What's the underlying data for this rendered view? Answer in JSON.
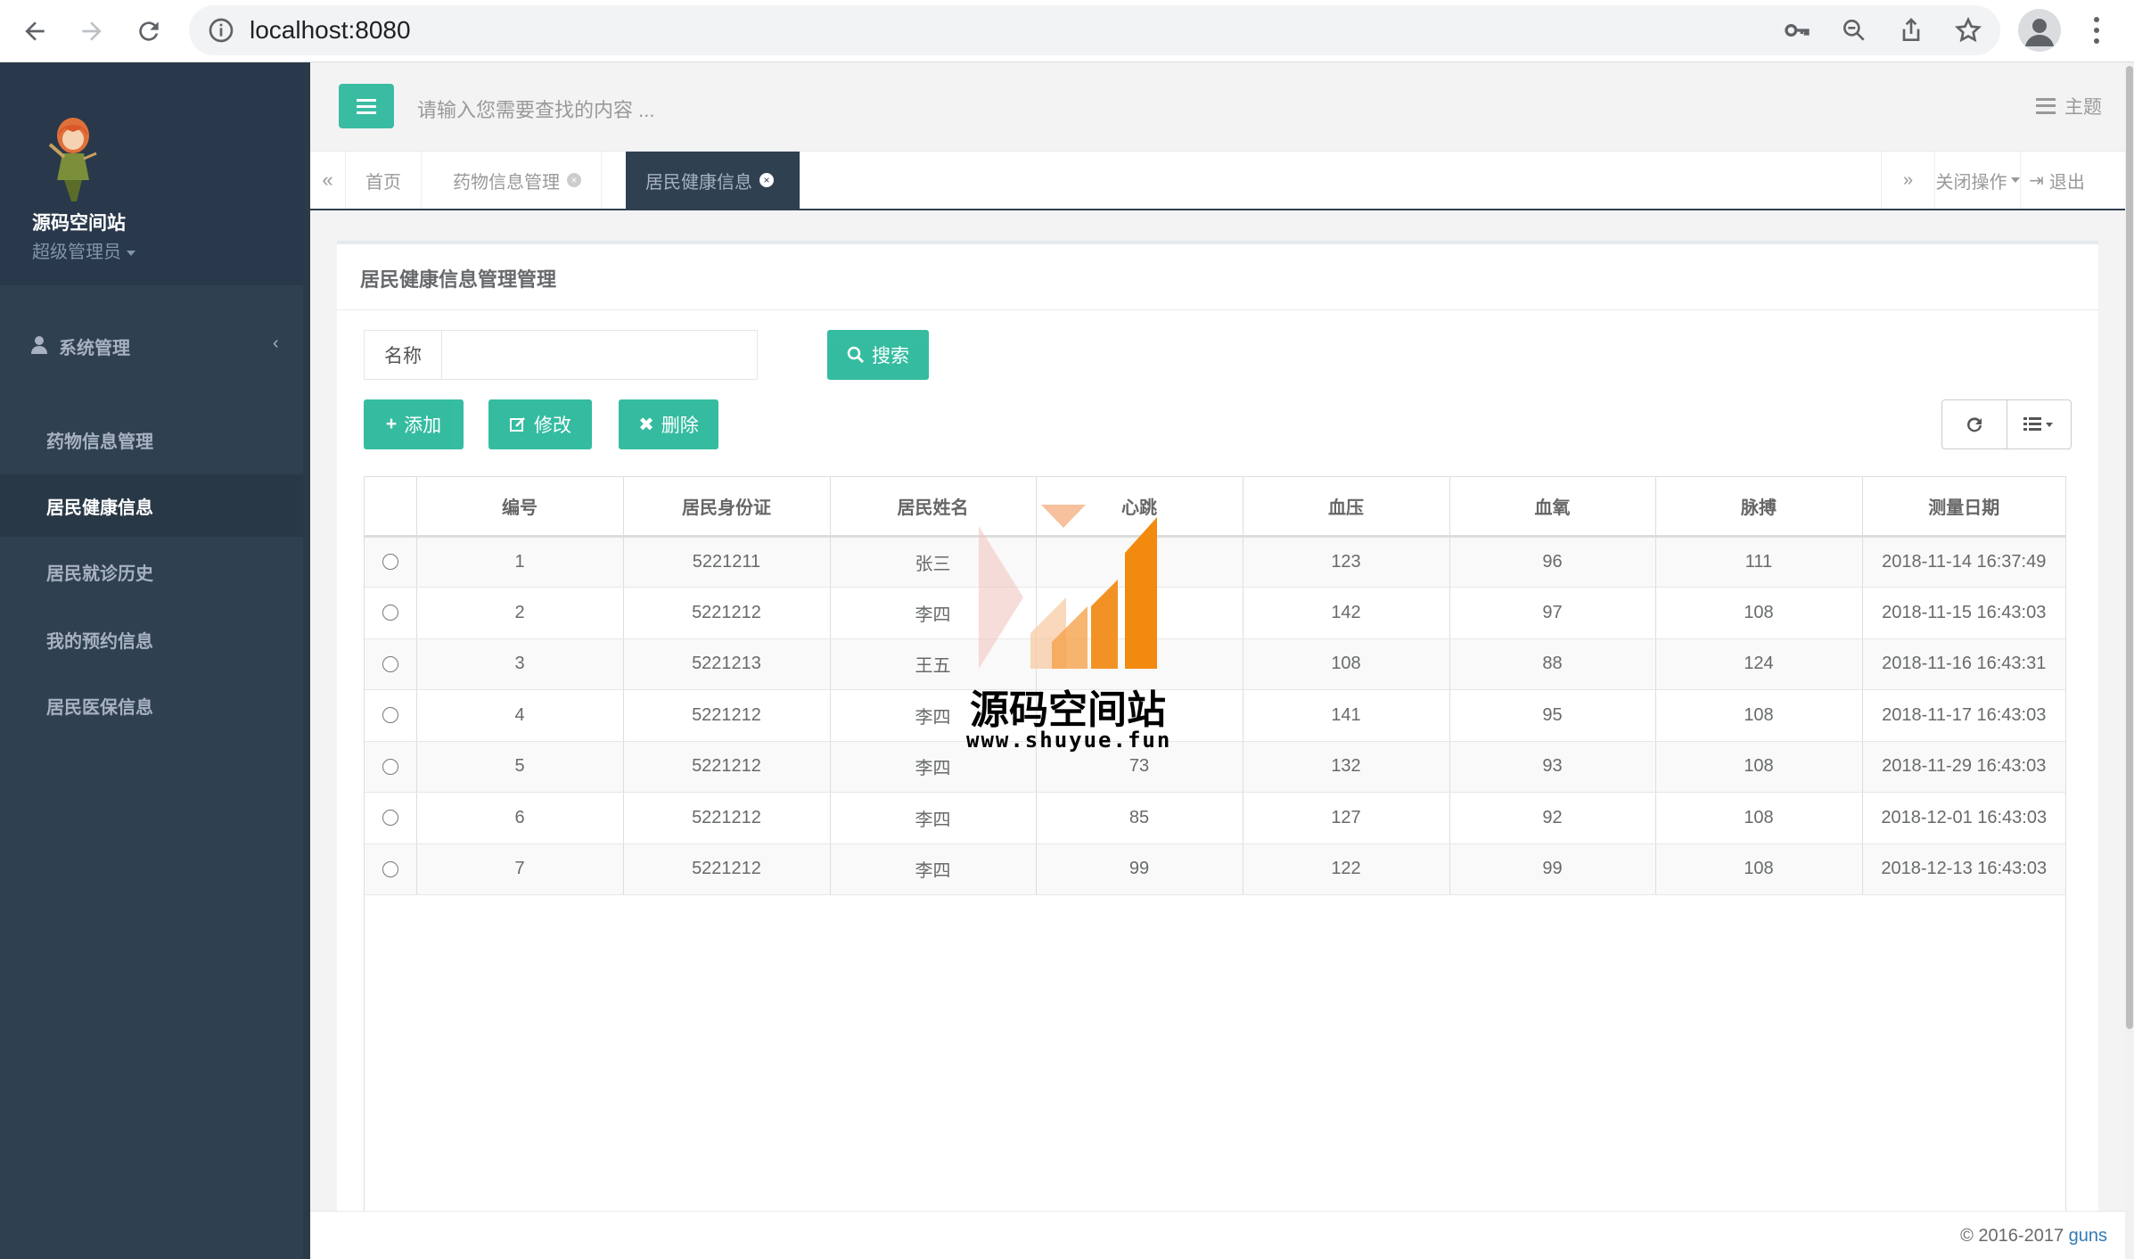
{
  "browser": {
    "url": "localhost:8080"
  },
  "sidebar": {
    "brand": "源码空间站",
    "role": "超级管理员",
    "section_label": "系统管理",
    "items": [
      {
        "label": "药物信息管理"
      },
      {
        "label": "居民健康信息"
      },
      {
        "label": "居民就诊历史"
      },
      {
        "label": "我的预约信息"
      },
      {
        "label": "居民医保信息"
      }
    ]
  },
  "topbar": {
    "search_placeholder": "请输入您需要查找的内容 ...",
    "theme_label": "主题"
  },
  "tabs": {
    "items": [
      {
        "label": "首页"
      },
      {
        "label": "药物信息管理"
      },
      {
        "label": "居民健康信息"
      }
    ],
    "close_ops": "关闭操作",
    "logout": "退出"
  },
  "panel": {
    "title": "居民健康信息管理管理",
    "search_label": "名称",
    "search_button": "搜索",
    "add_button": "添加",
    "edit_button": "修改",
    "delete_button": "删除"
  },
  "table": {
    "headers": [
      "编号",
      "居民身份证",
      "居民姓名",
      "心跳",
      "血压",
      "血氧",
      "脉搏",
      "测量日期"
    ],
    "rows": [
      [
        "1",
        "5221211",
        "张三",
        "",
        "123",
        "96",
        "111",
        "2018-11-14 16:37:49"
      ],
      [
        "2",
        "5221212",
        "李四",
        "",
        "142",
        "97",
        "108",
        "2018-11-15 16:43:03"
      ],
      [
        "3",
        "5221213",
        "王五",
        "77",
        "108",
        "88",
        "124",
        "2018-11-16 16:43:31"
      ],
      [
        "4",
        "5221212",
        "李四",
        "",
        "141",
        "95",
        "108",
        "2018-11-17 16:43:03"
      ],
      [
        "5",
        "5221212",
        "李四",
        "73",
        "132",
        "93",
        "108",
        "2018-11-29 16:43:03"
      ],
      [
        "6",
        "5221212",
        "李四",
        "85",
        "127",
        "92",
        "108",
        "2018-12-01 16:43:03"
      ],
      [
        "7",
        "5221212",
        "李四",
        "99",
        "122",
        "99",
        "108",
        "2018-12-13 16:43:03"
      ]
    ]
  },
  "footer": {
    "copyright": "© 2016-2017 ",
    "link": "guns"
  },
  "watermark": {
    "title": "源码空间站",
    "url": "www.shuyue.fun"
  },
  "colors": {
    "sidebar": "#2f4050",
    "accent": "#1ab394",
    "link": "#337ab7"
  }
}
